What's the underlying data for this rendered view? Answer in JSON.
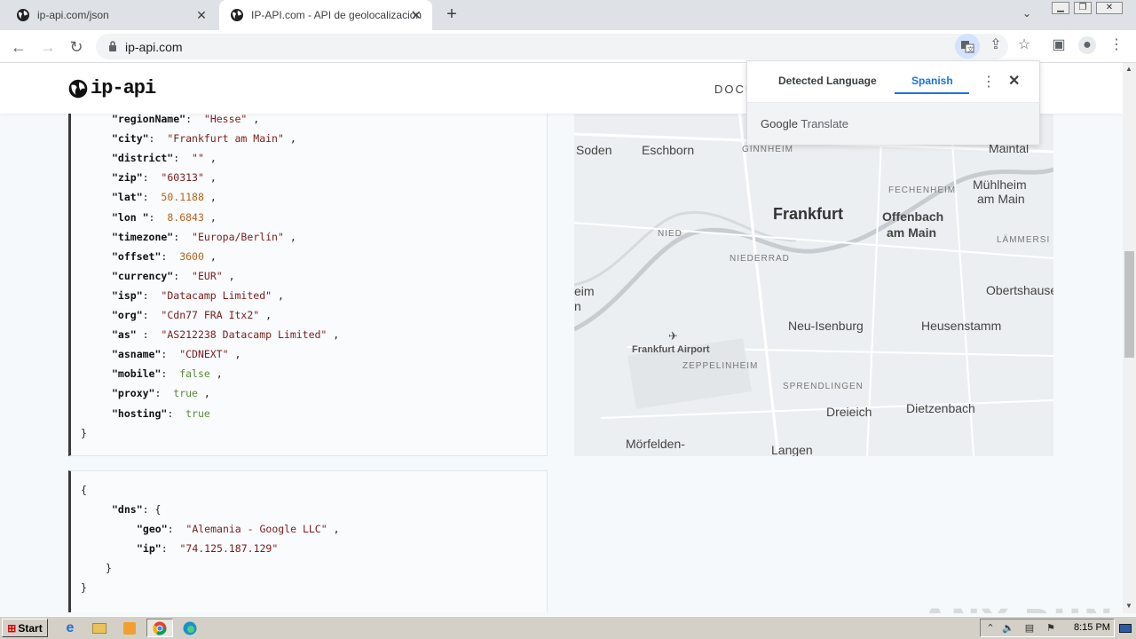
{
  "browser": {
    "tabs": [
      {
        "title": "ip-api.com/json",
        "active": false
      },
      {
        "title": "IP-API.com - API de geolocalización",
        "active": true
      }
    ],
    "url": "ip-api.com"
  },
  "site": {
    "logo_text": "ip-api",
    "nav_docs": "DOCU"
  },
  "code1": {
    "lines": [
      {
        "key": "\"regionName\"",
        "sep": ":",
        "val": "\"Hesse\"",
        "type": "s",
        "tail": ","
      },
      {
        "key": "\"city\"",
        "sep": ":",
        "val": "\"Frankfurt am Main\"",
        "type": "s",
        "tail": ","
      },
      {
        "key": "\"district\"",
        "sep": ":",
        "val": "\"\"",
        "type": "s",
        "tail": ","
      },
      {
        "key": "\"zip\"",
        "sep": ":",
        "val": "\"60313\"",
        "type": "s",
        "tail": ","
      },
      {
        "key": "\"lat\"",
        "sep": ":",
        "val": "50.1188",
        "type": "n",
        "tail": ","
      },
      {
        "key": "\"lon \"",
        "sep": ":",
        "val": "8.6843",
        "type": "n",
        "tail": ","
      },
      {
        "key": "\"timezone\"",
        "sep": ":",
        "val": "\"Europa/Berlín\"",
        "type": "s",
        "tail": ","
      },
      {
        "key": "\"offset\"",
        "sep": ":",
        "val": "3600",
        "type": "n",
        "tail": ","
      },
      {
        "key": "\"currency\"",
        "sep": ":",
        "val": "\"EUR\"",
        "type": "s",
        "tail": ","
      },
      {
        "key": "\"isp\"",
        "sep": ":",
        "val": "\"Datacamp Limited\"",
        "type": "s",
        "tail": ","
      },
      {
        "key": "\"org\"",
        "sep": ":",
        "val": "\"Cdn77 FRA Itx2\"",
        "type": "s",
        "tail": ","
      },
      {
        "key": "\"as\"",
        "sep": " :",
        "val": "\"AS212238 Datacamp Limited\"",
        "type": "s",
        "tail": ","
      },
      {
        "key": "\"asname\"",
        "sep": ":",
        "val": "\"CDNEXT\"",
        "type": "s",
        "tail": ","
      },
      {
        "key": "\"mobile\"",
        "sep": ":",
        "val": "false",
        "type": "b",
        "tail": ","
      },
      {
        "key": "\"proxy\"",
        "sep": ":",
        "val": "true",
        "type": "b",
        "tail": ","
      },
      {
        "key": "\"hosting\"",
        "sep": ":",
        "val": "true",
        "type": "b",
        "tail": ""
      }
    ],
    "close": "}"
  },
  "code2": {
    "open": "{",
    "dns_key": "\"dns\"",
    "dns_open": ": {",
    "geo_key": "\"geo\"",
    "geo_val": "\"Alemania - Google LLC\"",
    "ip_key": "\"ip\"",
    "ip_val": "\"74.125.187.129\"",
    "inner_close": "}",
    "close": "}"
  },
  "map": {
    "labels": {
      "soden": "Soden",
      "eschborn": "Eschborn",
      "ginnheim": "GINNHEIM",
      "maintal": "Maintal",
      "fechenheim": "FECHENHEIM",
      "muhlheim": "Mühlheim",
      "am_main": "am Main",
      "frankfurt": "Frankfurt",
      "offenbach": "Offenbach",
      "offenbach2": "am Main",
      "nied": "NIED",
      "niederrad": "NIEDERRAD",
      "lammers": "LÄMMERSI",
      "heim": "eim",
      "n": "n",
      "obertshausen": "Obertshause",
      "neu_isenburg": "Neu-Isenburg",
      "heusenstamm": "Heusenstamm",
      "airport": "Frankfurt Airport",
      "zeppelinheim": "ZEPPELINHEIM",
      "sprendlingen": "SPRENDLINGEN",
      "dreieich": "Dreieich",
      "dietzenbach": "Dietzenbach",
      "morfelden": "Mörfelden-",
      "langen": "Langen"
    }
  },
  "translate": {
    "detected": "Detected Language",
    "target": "Spanish",
    "brand_google": "Google",
    "brand_translate": "Translate"
  },
  "watermark": "ANY RUN",
  "taskbar": {
    "start": "Start",
    "time": "8:15 PM"
  }
}
